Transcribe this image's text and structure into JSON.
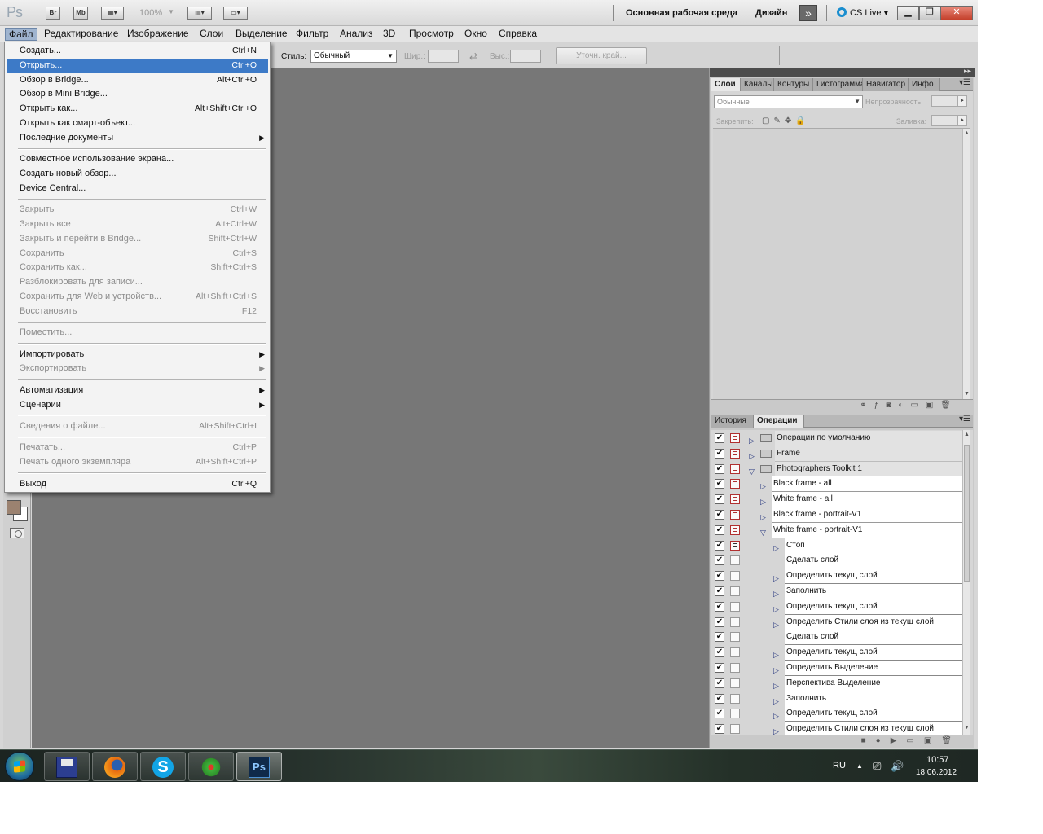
{
  "titlebar": {
    "logo": "Ps",
    "btn_bridge": "Br",
    "btn_minibridge": "Mb",
    "zoom": "100%",
    "workspace": "Основная рабочая среда",
    "workspace_design": "Дизайн",
    "more": "»",
    "cslive": "CS Live"
  },
  "menubar": [
    "Файл",
    "Редактирование",
    "Изображение",
    "Слои",
    "Выделение",
    "Фильтр",
    "Анализ",
    "3D",
    "Просмотр",
    "Окно",
    "Справка"
  ],
  "options": {
    "style_label": "Стиль:",
    "style_value": "Обычный",
    "width_label": "Шир.:",
    "height_label": "Выс.:",
    "refine_edge": "Уточн. край..."
  },
  "file_menu": [
    {
      "label": "Создать...",
      "shortcut": "Ctrl+N"
    },
    {
      "label": "Открыть...",
      "shortcut": "Ctrl+O",
      "highlighted": true
    },
    {
      "label": "Обзор в Bridge...",
      "shortcut": "Alt+Ctrl+O"
    },
    {
      "label": "Обзор в Mini Bridge...",
      "shortcut": ""
    },
    {
      "label": "Открыть как...",
      "shortcut": "Alt+Shift+Ctrl+O"
    },
    {
      "label": "Открыть как смарт-объект...",
      "shortcut": ""
    },
    {
      "label": "Последние документы",
      "shortcut": "",
      "submenu": true
    },
    {
      "label": "Совместное использование экрана...",
      "shortcut": ""
    },
    {
      "label": "Создать новый обзор...",
      "shortcut": ""
    },
    {
      "label": "Device Central...",
      "shortcut": ""
    },
    {
      "label": "Закрыть",
      "shortcut": "Ctrl+W",
      "disabled": true
    },
    {
      "label": "Закрыть все",
      "shortcut": "Alt+Ctrl+W",
      "disabled": true
    },
    {
      "label": "Закрыть и перейти в Bridge...",
      "shortcut": "Shift+Ctrl+W",
      "disabled": true
    },
    {
      "label": "Сохранить",
      "shortcut": "Ctrl+S",
      "disabled": true
    },
    {
      "label": "Сохранить как...",
      "shortcut": "Shift+Ctrl+S",
      "disabled": true
    },
    {
      "label": "Разблокировать для записи...",
      "shortcut": "",
      "disabled": true
    },
    {
      "label": "Сохранить для Web и устройств...",
      "shortcut": "Alt+Shift+Ctrl+S",
      "disabled": true
    },
    {
      "label": "Восстановить",
      "shortcut": "F12",
      "disabled": true
    },
    {
      "label": "Поместить...",
      "shortcut": "",
      "disabled": true
    },
    {
      "label": "Импортировать",
      "shortcut": "",
      "submenu": true
    },
    {
      "label": "Экспортировать",
      "shortcut": "",
      "submenu": true,
      "disabled": true
    },
    {
      "label": "Автоматизация",
      "shortcut": "",
      "submenu": true
    },
    {
      "label": "Сценарии",
      "shortcut": "",
      "submenu": true
    },
    {
      "label": "Сведения о файле...",
      "shortcut": "Alt+Shift+Ctrl+I",
      "disabled": true
    },
    {
      "label": "Печатать...",
      "shortcut": "Ctrl+P",
      "disabled": true
    },
    {
      "label": "Печать одного экземпляра",
      "shortcut": "Alt+Shift+Ctrl+P",
      "disabled": true
    },
    {
      "label": "Выход",
      "shortcut": "Ctrl+Q"
    }
  ],
  "layers_panel": {
    "tabs": [
      "Слои",
      "Каналы",
      "Контуры",
      "Гистограмма",
      "Навигатор",
      "Инфо"
    ],
    "blend_mode": "Обычные",
    "opacity_label": "Непрозрачность:",
    "lock_label": "Закрепить:",
    "fill_label": "Заливка:"
  },
  "actions_panel": {
    "tabs": [
      "История",
      "Операции"
    ],
    "rows": [
      {
        "label": "Операции по умолчанию",
        "kind": "set",
        "expanded": false,
        "dialog": true
      },
      {
        "label": "Frame",
        "kind": "set",
        "expanded": false,
        "dialog": true
      },
      {
        "label": "Photographers Toolkit 1",
        "kind": "set",
        "expanded": true,
        "dialog": true
      },
      {
        "label": "Black frame - all",
        "kind": "action",
        "expanded": false,
        "dialog": true
      },
      {
        "label": "White frame - all",
        "kind": "action",
        "expanded": false,
        "dialog": true
      },
      {
        "label": "Black frame - portrait-V1",
        "kind": "action",
        "expanded": false,
        "dialog": true
      },
      {
        "label": "White frame - portrait-V1",
        "kind": "action",
        "expanded": true,
        "dialog": true
      },
      {
        "label": "Стоп",
        "kind": "step",
        "expandable": true,
        "dialog": true
      },
      {
        "label": "Сделать слой",
        "kind": "step",
        "expandable": false,
        "dialog": false
      },
      {
        "label": "Определить текущ слой",
        "kind": "step",
        "expandable": true,
        "dialog": false
      },
      {
        "label": "Заполнить",
        "kind": "step",
        "expandable": true,
        "dialog": false
      },
      {
        "label": "Определить текущ слой",
        "kind": "step",
        "expandable": true,
        "dialog": false
      },
      {
        "label": "Определить Стили слоя из текущ слой",
        "kind": "step",
        "expandable": true,
        "dialog": false
      },
      {
        "label": "Сделать слой",
        "kind": "step",
        "expandable": false,
        "dialog": false
      },
      {
        "label": "Определить текущ слой",
        "kind": "step",
        "expandable": true,
        "dialog": false
      },
      {
        "label": "Определить Выделение",
        "kind": "step",
        "expandable": true,
        "dialog": false
      },
      {
        "label": "Перспектива Выделение",
        "kind": "step",
        "expandable": true,
        "dialog": false
      },
      {
        "label": "Заполнить",
        "kind": "step",
        "expandable": true,
        "dialog": false
      },
      {
        "label": "Определить текущ слой",
        "kind": "step",
        "expandable": true,
        "dialog": false
      },
      {
        "label": "Определить Стили слоя из текущ слой",
        "kind": "step",
        "expandable": true,
        "dialog": false
      }
    ]
  },
  "taskbar": {
    "lang": "RU",
    "time": "10:57",
    "date": "18.06.2012"
  },
  "colors": {
    "canvas": "#777777",
    "menu_highlight": "#3d7ac7",
    "foreground_swatch": "#9b8270"
  }
}
